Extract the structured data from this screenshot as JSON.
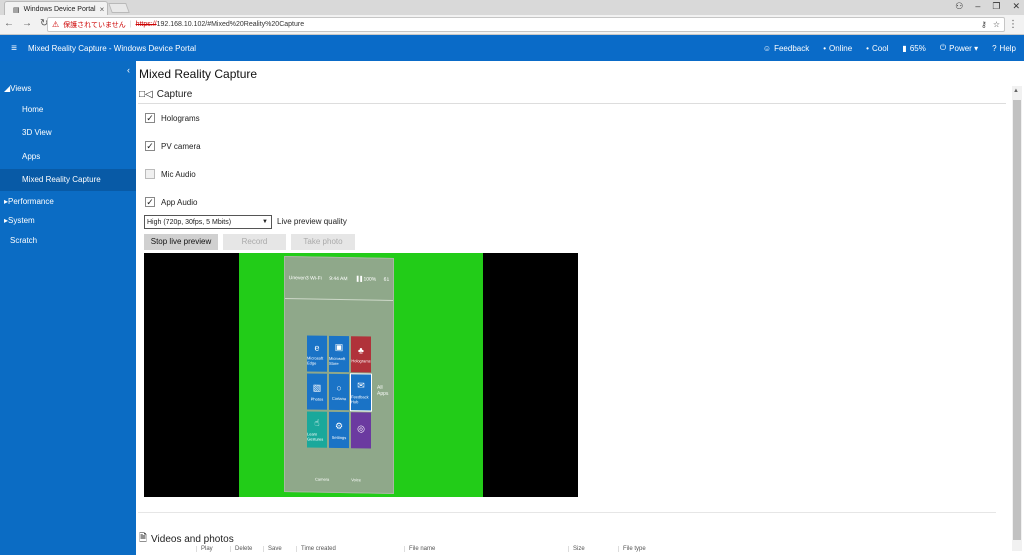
{
  "browser": {
    "tab_title": "Windows Device Portal",
    "tab_close": "×",
    "window_controls": {
      "user": "⚇",
      "minimize": "–",
      "restore": "❐",
      "close": "✕"
    },
    "security_warning": "保護されていません",
    "url_scheme": "https://",
    "url_rest": "192.168.10.102/#Mixed%20Reality%20Capture",
    "icons": [
      "back-icon",
      "forward-icon",
      "reload-icon",
      "key-icon",
      "star-icon",
      "menu-icon"
    ]
  },
  "header": {
    "title": "Mixed Reality Capture - Windows Device Portal",
    "items": [
      {
        "icon": "☺",
        "label": "Feedback"
      },
      {
        "icon": "•",
        "label": "Online"
      },
      {
        "icon": "•",
        "label": "Cool"
      },
      {
        "icon": "▮",
        "label": "65%"
      },
      {
        "icon": "⏻",
        "label": "Power ▾"
      },
      {
        "icon": "?",
        "label": "Help"
      }
    ]
  },
  "sidebar": {
    "views": "◢Views",
    "items": [
      "Home",
      "3D View",
      "Apps",
      "Mixed Reality Capture"
    ],
    "performance": "▸Performance",
    "system": "▸System",
    "scratch": "Scratch"
  },
  "main": {
    "title": "Mixed Reality Capture",
    "section_title": "Capture",
    "checkboxes": [
      {
        "label": "Holograms",
        "checked": true
      },
      {
        "label": "PV camera",
        "checked": true
      },
      {
        "label": "Mic Audio",
        "checked": false
      },
      {
        "label": "App Audio",
        "checked": true
      }
    ],
    "quality_selected": "High (720p, 30fps, 5 Mbits)",
    "quality_label": "Live preview quality",
    "buttons": {
      "stop": "Stop live preview",
      "record": "Record",
      "photo": "Take photo"
    },
    "videos_title": "Videos and photos",
    "table_headers": [
      "Play",
      "Delete",
      "Save",
      "Time created",
      "File name",
      "Size",
      "File type"
    ]
  },
  "preview": {
    "time": "9:44 AM",
    "status_a": "Uneven3 Wi-Fi",
    "status_b": "▐▐ 100%",
    "status_c": "61",
    "tiles": [
      {
        "label": "Microsoft Edge",
        "glyph": "e",
        "color": "#1a73c6"
      },
      {
        "label": "Microsoft Store",
        "glyph": "▣",
        "color": "#1a73c6"
      },
      {
        "label": "Holograms",
        "glyph": "♣",
        "color": "#b0323a"
      },
      {
        "label": "Photos",
        "glyph": "▧",
        "color": "#1a73c6"
      },
      {
        "label": "Cortana",
        "glyph": "○",
        "color": "#1a73c6"
      },
      {
        "label": "Feedback Hub",
        "glyph": "✉",
        "color": "#1a73c6"
      },
      {
        "label": "Learn Gestures",
        "glyph": "☝",
        "color": "#1aa89b"
      },
      {
        "label": "Settings",
        "glyph": "⚙",
        "color": "#1a73c6"
      },
      {
        "label": "",
        "glyph": "◎",
        "color": "#6b3aa0"
      }
    ],
    "side_label": "All Apps",
    "bottom": [
      "Camera",
      "Voice"
    ]
  }
}
